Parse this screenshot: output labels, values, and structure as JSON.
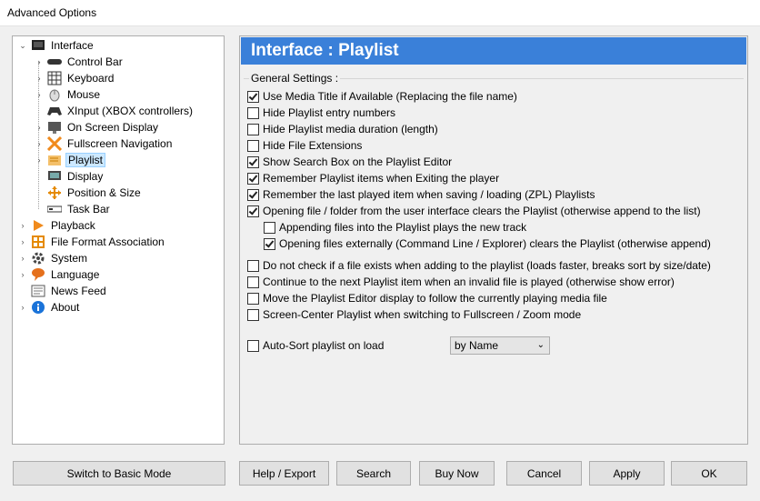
{
  "window": {
    "title": "Advanced Options"
  },
  "tree": {
    "items": [
      {
        "label": "Interface",
        "icon": "interface-icon",
        "expanded": true
      },
      {
        "label": "Control Bar",
        "icon": "control-bar-icon"
      },
      {
        "label": "Keyboard",
        "icon": "keyboard-icon"
      },
      {
        "label": "Mouse",
        "icon": "mouse-icon"
      },
      {
        "label": "XInput (XBOX controllers)",
        "icon": "gamepad-icon"
      },
      {
        "label": "On Screen Display",
        "icon": "osd-icon"
      },
      {
        "label": "Fullscreen Navigation",
        "icon": "fullscreen-icon"
      },
      {
        "label": "Playlist",
        "icon": "playlist-icon",
        "selected": true
      },
      {
        "label": "Display",
        "icon": "display-icon"
      },
      {
        "label": "Position & Size",
        "icon": "position-icon"
      },
      {
        "label": "Task Bar",
        "icon": "taskbar-icon"
      },
      {
        "label": "Playback",
        "icon": "playback-icon"
      },
      {
        "label": "File Format Association",
        "icon": "file-format-icon"
      },
      {
        "label": "System",
        "icon": "gear-icon"
      },
      {
        "label": "Language",
        "icon": "language-icon"
      },
      {
        "label": "News Feed",
        "icon": "news-icon"
      },
      {
        "label": "About",
        "icon": "info-icon"
      }
    ]
  },
  "panel": {
    "title": "Interface : Playlist",
    "group_title": "General Settings :",
    "options": [
      {
        "label": "Use Media Title if Available (Replacing the file name)",
        "checked": true
      },
      {
        "label": "Hide Playlist entry numbers",
        "checked": false
      },
      {
        "label": "Hide Playlist media duration (length)",
        "checked": false
      },
      {
        "label": "Hide File Extensions",
        "checked": false
      },
      {
        "label": "Show Search Box on the Playlist Editor",
        "checked": true
      },
      {
        "label": "Remember Playlist items when Exiting the player",
        "checked": true
      },
      {
        "label": "Remember the last played item when saving / loading (ZPL) Playlists",
        "checked": true
      },
      {
        "label": "Opening file / folder from the user interface clears the Playlist (otherwise append to the list)",
        "checked": true
      },
      {
        "label": "Appending files into the Playlist plays the new track",
        "checked": false
      },
      {
        "label": "Opening files externally (Command Line / Explorer) clears the Playlist (otherwise append)",
        "checked": true
      },
      {
        "label": "Do not check if a file exists when adding to the playlist (loads faster, breaks sort by size/date)",
        "checked": false
      },
      {
        "label": "Continue to the next Playlist item when an invalid file is played (otherwise show error)",
        "checked": false
      },
      {
        "label": "Move the Playlist Editor display to follow the currently playing media file",
        "checked": false
      },
      {
        "label": "Screen-Center Playlist when switching to Fullscreen / Zoom mode",
        "checked": false
      },
      {
        "label": "Auto-Sort playlist on load",
        "checked": false
      }
    ],
    "sort_select": {
      "value": "by Name"
    }
  },
  "buttons": {
    "basic_mode": "Switch to Basic Mode",
    "help_export": "Help / Export",
    "search": "Search",
    "buy_now": "Buy Now",
    "cancel": "Cancel",
    "apply": "Apply",
    "ok": "OK"
  }
}
